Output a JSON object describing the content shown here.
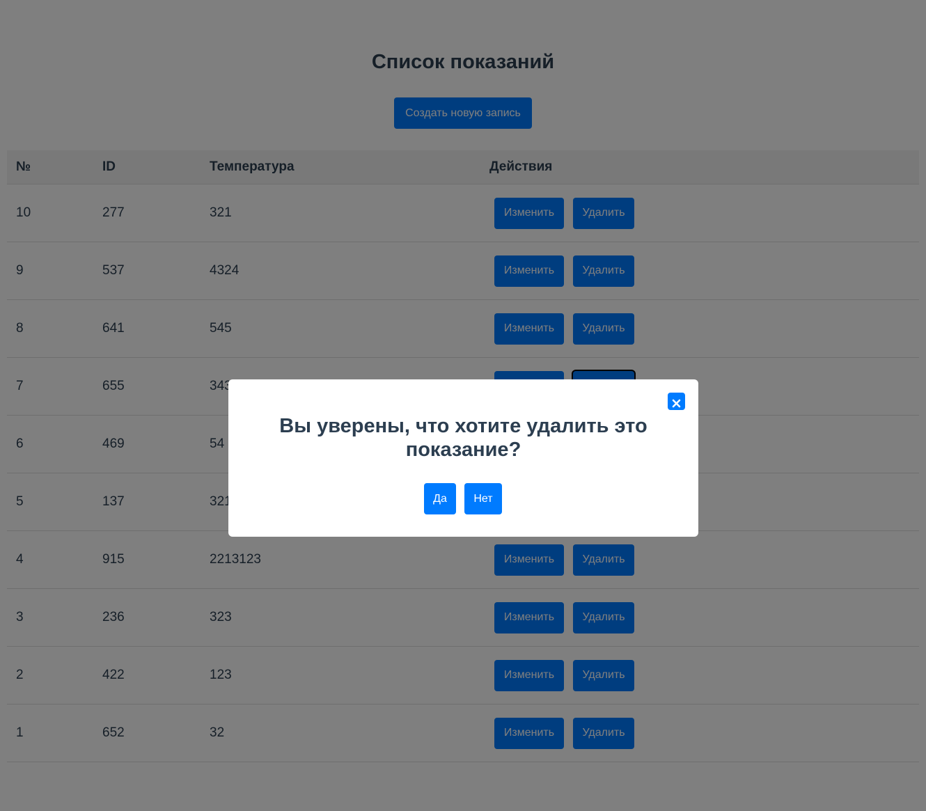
{
  "page": {
    "title": "Список показаний",
    "create_label": "Создать новую запись"
  },
  "table": {
    "headers": [
      "№",
      "ID",
      "Температура",
      "Действия"
    ],
    "edit_label": "Изменить",
    "delete_label": "Удалить",
    "rows": [
      {
        "num": "10",
        "id": "277",
        "temperature": "321"
      },
      {
        "num": "9",
        "id": "537",
        "temperature": "4324"
      },
      {
        "num": "8",
        "id": "641",
        "temperature": "545"
      },
      {
        "num": "7",
        "id": "655",
        "temperature": "343"
      },
      {
        "num": "6",
        "id": "469",
        "temperature": "54"
      },
      {
        "num": "5",
        "id": "137",
        "temperature": "321"
      },
      {
        "num": "4",
        "id": "915",
        "temperature": "2213123"
      },
      {
        "num": "3",
        "id": "236",
        "temperature": "323"
      },
      {
        "num": "2",
        "id": "422",
        "temperature": "123"
      },
      {
        "num": "1",
        "id": "652",
        "temperature": "32"
      }
    ]
  },
  "modal": {
    "message": "Вы уверены, что хотите удалить это показание?",
    "yes_label": "Да",
    "no_label": "Нет",
    "close_icon": "close-icon"
  },
  "colors": {
    "accent": "#007bff",
    "text": "#2c3e50",
    "overlay": "rgba(0,0,0,0.5)"
  }
}
